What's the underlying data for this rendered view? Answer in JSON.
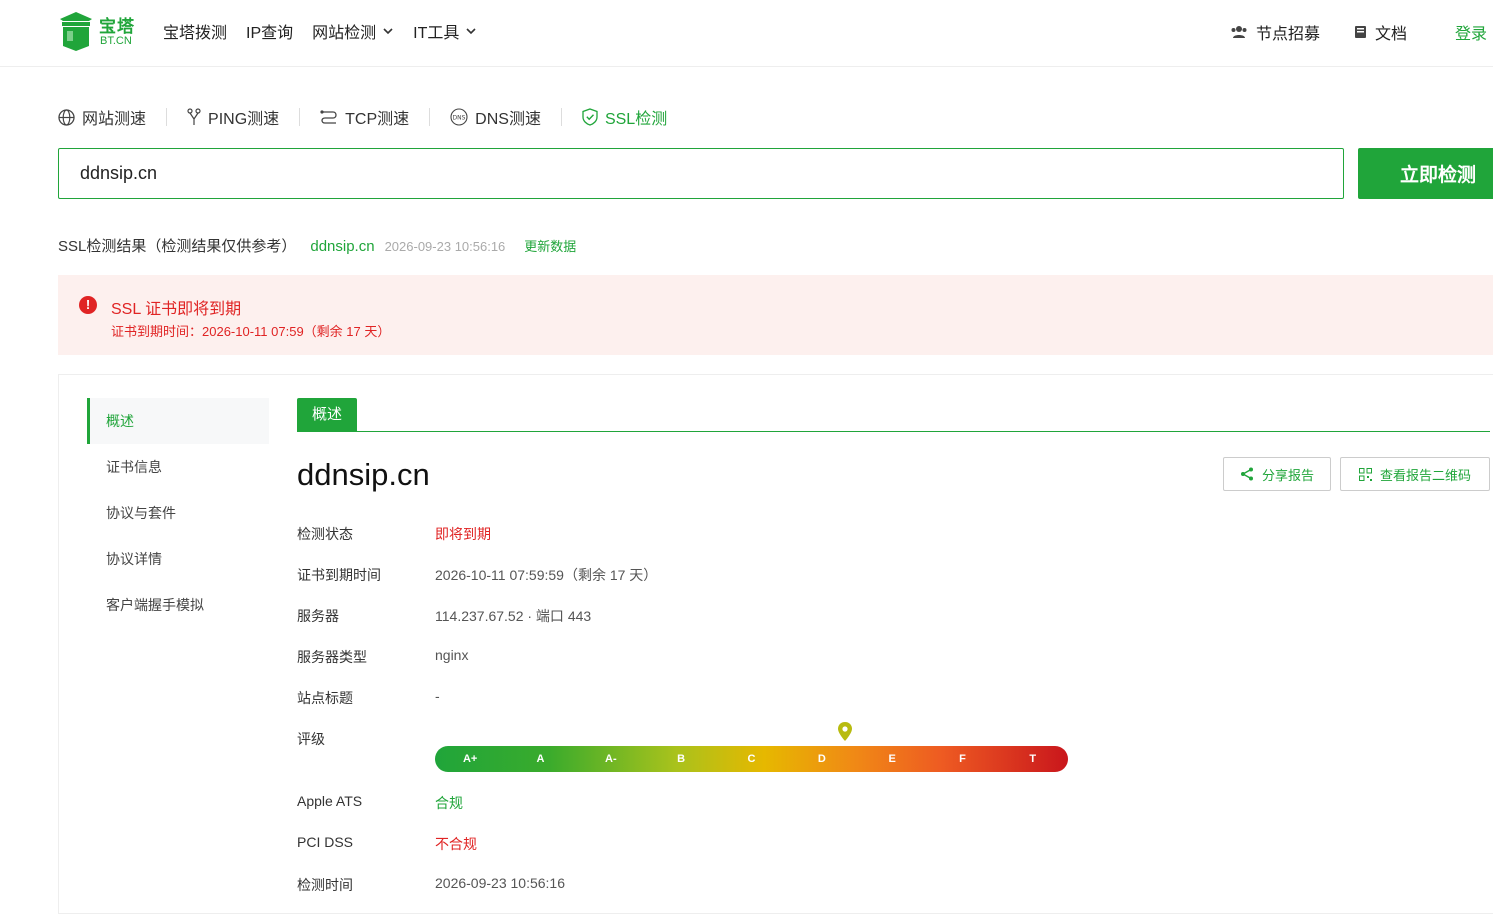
{
  "header": {
    "logo_cn": "宝塔",
    "logo_en": "BT.CN",
    "nav": [
      "宝塔拨测",
      "IP查询",
      "网站检测",
      "IT工具"
    ],
    "recruit": "节点招募",
    "docs": "文档",
    "login": "登录"
  },
  "tools": {
    "speed": "网站测速",
    "ping": "PING测速",
    "tcp": "TCP测速",
    "dns": "DNS测速",
    "ssl": "SSL检测"
  },
  "search": {
    "value": "ddnsip.cn",
    "button": "立即检测"
  },
  "result": {
    "title": "SSL检测结果（检测结果仅供参考）",
    "domain": "ddnsip.cn",
    "time": "2026-09-23 10:56:16",
    "refresh": "更新数据"
  },
  "alert": {
    "icon": "!",
    "title": "SSL 证书即将到期",
    "sub": "证书到期时间：2026-10-11 07:59（剩余 17 天）",
    "color": "#e02424"
  },
  "sidebar": [
    "概述",
    "证书信息",
    "协议与套件",
    "协议详情",
    "客户端握手模拟"
  ],
  "tab": "概述",
  "overview": {
    "domain": "ddnsip.cn",
    "share": "分享报告",
    "qr": "查看报告二维码",
    "rows": [
      {
        "k": "检测状态",
        "v": "即将到期"
      },
      {
        "k": "证书到期时间",
        "v": "2026-10-11 07:59:59（剩余 17 天）"
      },
      {
        "k": "服务器",
        "v": "114.237.67.52 · 端口 443"
      },
      {
        "k": "服务器类型",
        "v": "nginx"
      },
      {
        "k": "站点标题",
        "v": "-"
      },
      {
        "k": "评级",
        "v": ""
      },
      {
        "k": "Apple ATS",
        "v": "合规"
      },
      {
        "k": "PCI DSS",
        "v": "不合规"
      },
      {
        "k": "检测时间",
        "v": "2026-09-23 10:56:16"
      }
    ],
    "grades": [
      "A+",
      "A",
      "A-",
      "B",
      "C",
      "D",
      "E",
      "F",
      "T"
    ],
    "current_grade": "D"
  },
  "colors": {
    "brand": "#20a53a",
    "danger": "#e02424"
  }
}
